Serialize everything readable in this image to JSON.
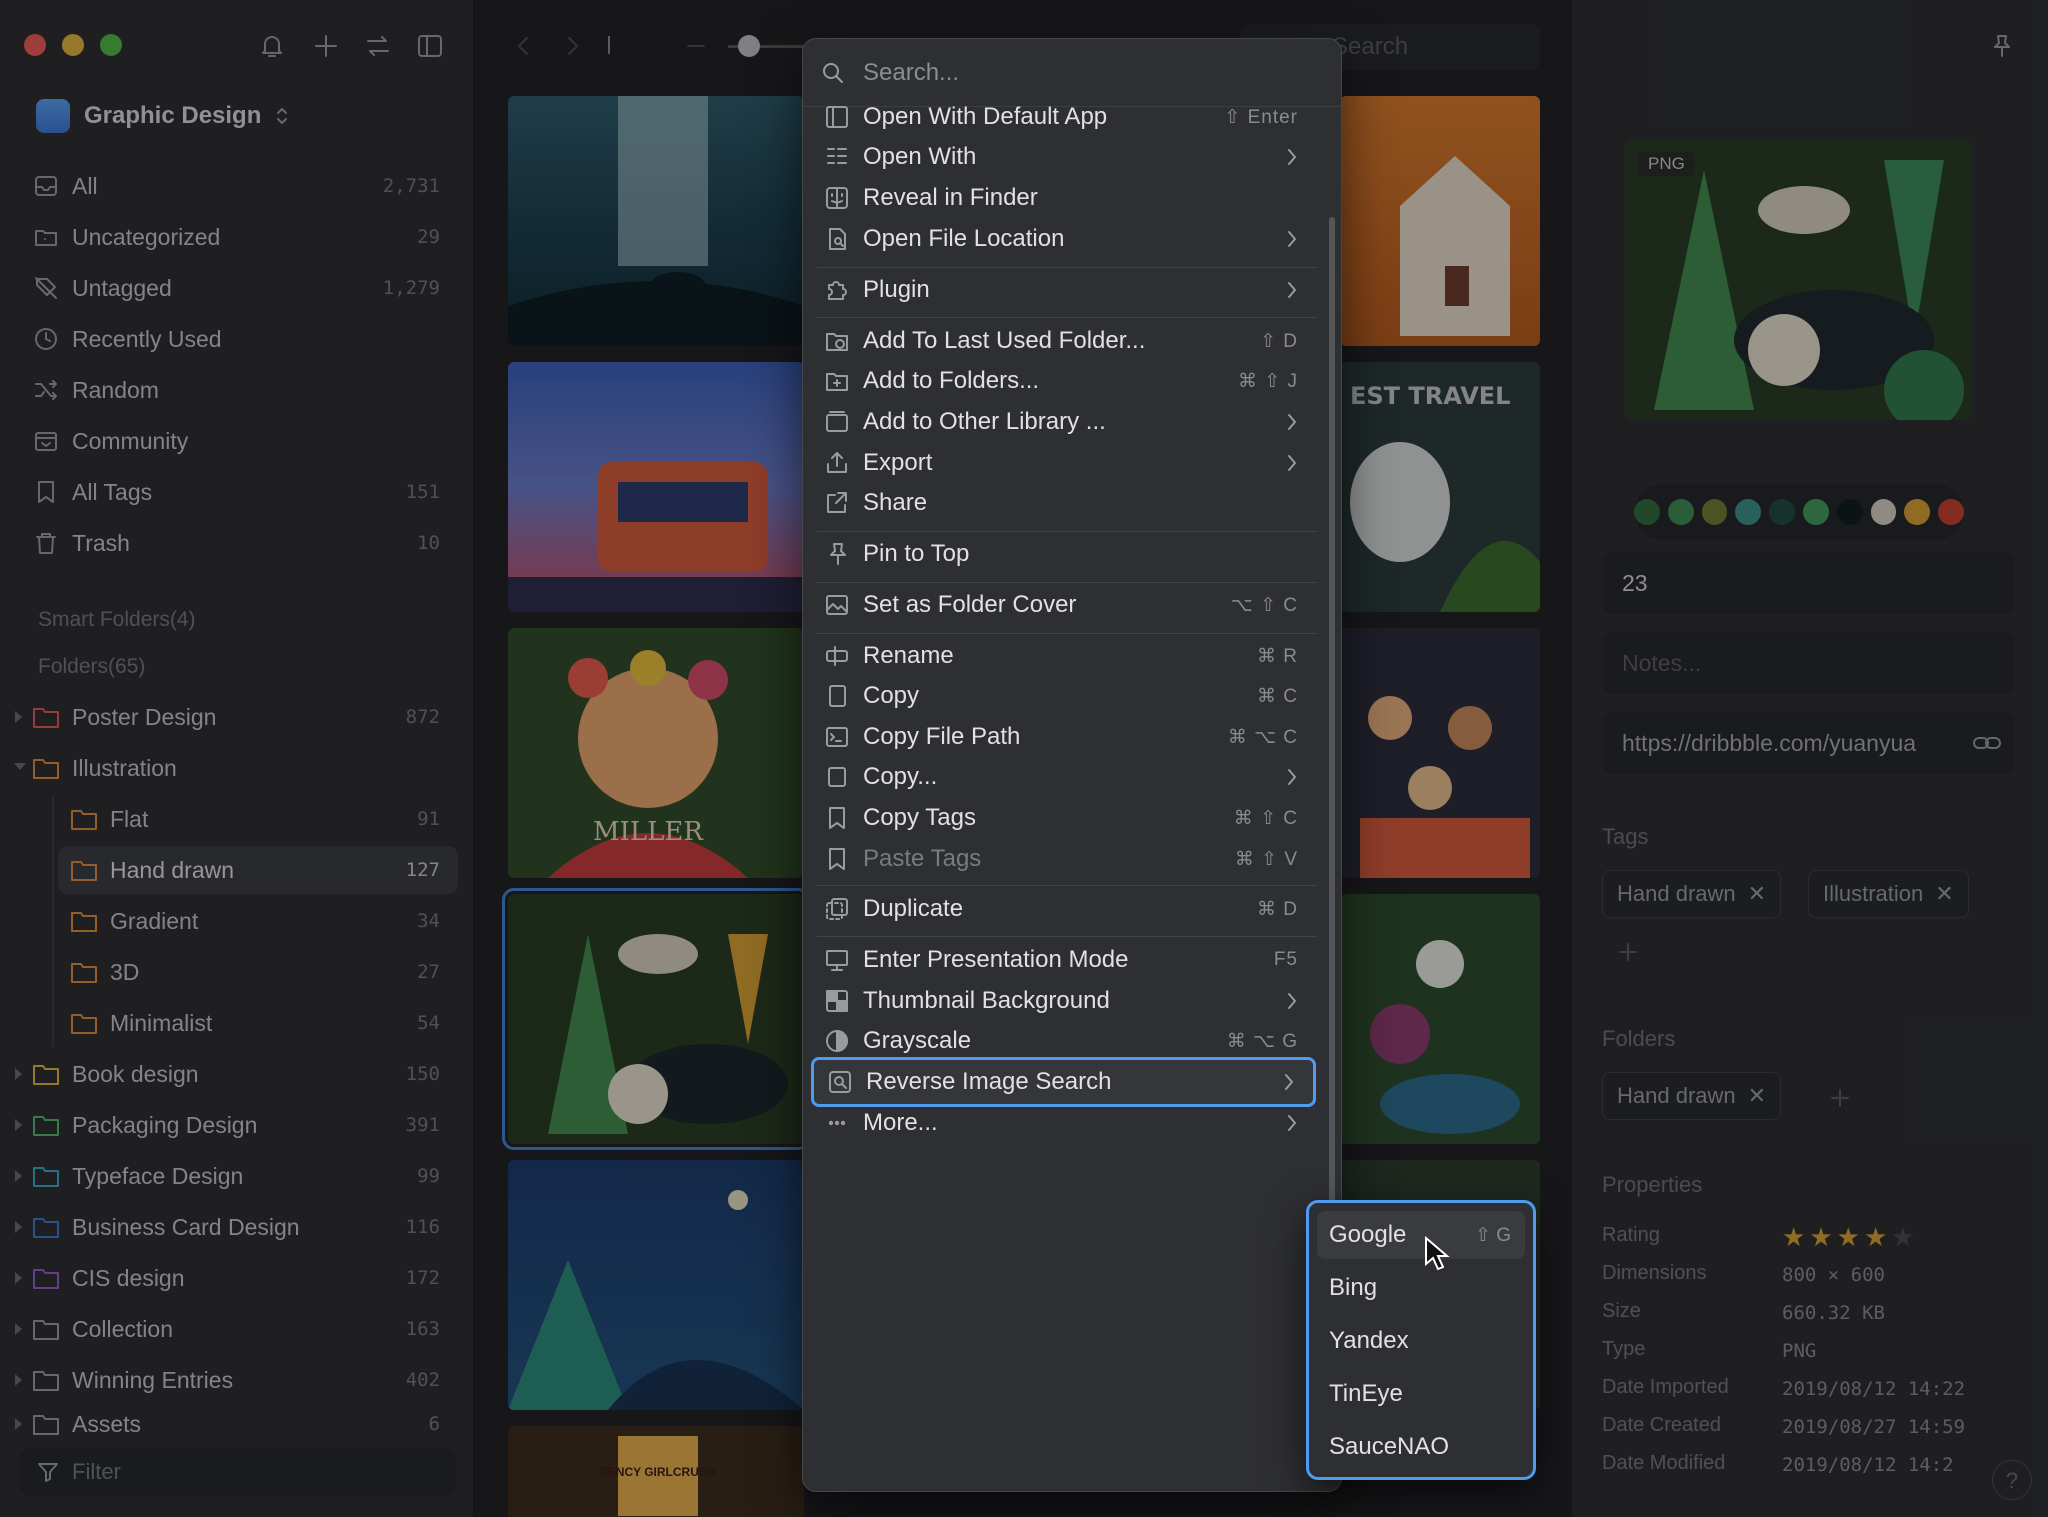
{
  "library": {
    "name": "Graphic Design"
  },
  "nav": [
    {
      "label": "All",
      "count": "2,731",
      "icon": "inbox-icon"
    },
    {
      "label": "Uncategorized",
      "count": "29",
      "icon": "folder-question-icon"
    },
    {
      "label": "Untagged",
      "count": "1,279",
      "icon": "tag-off-icon"
    },
    {
      "label": "Recently Used",
      "count": "",
      "icon": "clock-icon"
    },
    {
      "label": "Random",
      "count": "",
      "icon": "shuffle-icon"
    },
    {
      "label": "Community",
      "count": "",
      "icon": "community-box-icon"
    },
    {
      "label": "All Tags",
      "count": "151",
      "icon": "bookmark-icon"
    },
    {
      "label": "Trash",
      "count": "10",
      "icon": "trash-icon"
    }
  ],
  "sections": {
    "smart": "Smart Folders(4)",
    "folders": "Folders(65)"
  },
  "folders": [
    {
      "label": "Poster Design",
      "count": "872",
      "color": "#e05a5a"
    },
    {
      "label": "Illustration",
      "count": "",
      "color": "#e08a3a"
    },
    {
      "label": "Flat",
      "count": "91",
      "color": "#e08a3a"
    },
    {
      "label": "Hand drawn",
      "count": "127",
      "color": "#e08a3a"
    },
    {
      "label": "Gradient",
      "count": "34",
      "color": "#e08a3a"
    },
    {
      "label": "3D",
      "count": "27",
      "color": "#e08a3a"
    },
    {
      "label": "Minimalist",
      "count": "54",
      "color": "#e08a3a"
    },
    {
      "label": "Book design",
      "count": "150",
      "color": "#e0b83a"
    },
    {
      "label": "Packaging Design",
      "count": "391",
      "color": "#4fb86a"
    },
    {
      "label": "Typeface Design",
      "count": "99",
      "color": "#3aa8c8"
    },
    {
      "label": "Business Card Design",
      "count": "116",
      "color": "#3a7ad0"
    },
    {
      "label": "CIS design",
      "count": "172",
      "color": "#9a5ad0"
    },
    {
      "label": "Collection",
      "count": "163",
      "color": "#9a9ba0"
    },
    {
      "label": "Winning Entries",
      "count": "402",
      "color": "#9a9ba0"
    },
    {
      "label": "Assets",
      "count": "6",
      "color": "#9a9ba0"
    }
  ],
  "filter_placeholder": "Filter",
  "toolbar": {
    "search_placeholder": "Search"
  },
  "menu": {
    "search_placeholder": "Search...",
    "items": [
      {
        "label": "Open With Default App",
        "shortcut": "⇧ Enter",
        "icon": "open-app-icon"
      },
      {
        "label": "Open With",
        "icon": "apps-grid-icon",
        "sub": true
      },
      {
        "label": "Reveal in Finder",
        "icon": "finder-icon"
      },
      {
        "label": "Open File Location",
        "icon": "file-search-icon",
        "sub": true
      },
      {
        "label": "Plugin",
        "icon": "puzzle-icon",
        "sub": true
      },
      {
        "label": "Add To Last Used Folder...",
        "shortcut": "⇧ D",
        "icon": "folder-clock-icon"
      },
      {
        "label": "Add to Folders...",
        "shortcut": "⌘ ⇧ J",
        "icon": "folder-add-icon"
      },
      {
        "label": "Add to Other Library ...",
        "icon": "library-icon",
        "sub": true
      },
      {
        "label": "Export",
        "icon": "export-icon",
        "sub": true
      },
      {
        "label": "Share",
        "icon": "share-icon"
      },
      {
        "label": "Pin to Top",
        "icon": "pin-icon"
      },
      {
        "label": "Set as Folder Cover",
        "shortcut": "⌥ ⇧ C",
        "icon": "image-cover-icon"
      },
      {
        "label": "Rename",
        "shortcut": "⌘ R",
        "icon": "rename-icon"
      },
      {
        "label": "Copy",
        "shortcut": "⌘ C",
        "icon": "copy-icon"
      },
      {
        "label": "Copy File Path",
        "shortcut": "⌘ ⌥ C",
        "icon": "terminal-icon"
      },
      {
        "label": "Copy...",
        "icon": "copy-more-icon",
        "sub": true
      },
      {
        "label": "Copy Tags",
        "shortcut": "⌘ ⇧ C",
        "icon": "tag-copy-icon"
      },
      {
        "label": "Paste Tags",
        "shortcut": "⌘ ⇧ V",
        "icon": "tag-paste-icon",
        "disabled": true
      },
      {
        "label": "Duplicate",
        "shortcut": "⌘ D",
        "icon": "duplicate-icon"
      },
      {
        "label": "Enter Presentation Mode",
        "shortcut": "F5",
        "icon": "presentation-icon"
      },
      {
        "label": "Thumbnail Background",
        "icon": "checkerboard-icon",
        "sub": true
      },
      {
        "label": "Grayscale",
        "shortcut": "⌘ ⌥ G",
        "icon": "grayscale-icon"
      },
      {
        "label": "Reverse Image Search",
        "icon": "image-search-icon",
        "sub": true
      },
      {
        "label": "More...",
        "icon": "more-icon",
        "sub": true
      }
    ]
  },
  "submenu": [
    {
      "label": "Google",
      "shortcut": "⇧ G"
    },
    {
      "label": "Bing"
    },
    {
      "label": "Yandex"
    },
    {
      "label": "TinEye"
    },
    {
      "label": "SauceNAO"
    }
  ],
  "inspector": {
    "badge": "PNG",
    "palette": [
      "#2e6a3a",
      "#3e8a52",
      "#6f7a32",
      "#3a8f86",
      "#1e4a3c",
      "#3f9a5c",
      "#0f1a1c",
      "#d9d2c2",
      "#d8a032",
      "#c8402e"
    ],
    "title": "23",
    "notes_placeholder": "Notes...",
    "url": "https://dribbble.com/yuanyua",
    "tags_title": "Tags",
    "tags": [
      "Hand drawn",
      "Illustration"
    ],
    "folders_title": "Folders",
    "folders": [
      "Hand drawn"
    ],
    "properties_title": "Properties",
    "properties": [
      {
        "k": "Rating",
        "v": ""
      },
      {
        "k": "Dimensions",
        "v": "800 × 600"
      },
      {
        "k": "Size",
        "v": "660.32 KB"
      },
      {
        "k": "Type",
        "v": "PNG"
      },
      {
        "k": "Date Imported",
        "v": "2019/08/12 14:22"
      },
      {
        "k": "Date Created",
        "v": "2019/08/27 14:59"
      },
      {
        "k": "Date Modified",
        "v": "2019/08/12 14:2"
      }
    ],
    "rating": 4,
    "rating_max": 5
  },
  "thumbnails": {
    "travel_text": "EST TRAVEL",
    "miller_text": "MILLER",
    "fency_text": "FENCY GIRLCRUSH"
  }
}
